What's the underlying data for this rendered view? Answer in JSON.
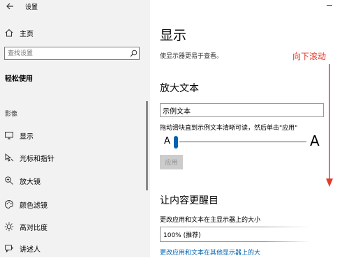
{
  "window": {
    "title": "设置"
  },
  "sidebar": {
    "home_label": "主页",
    "search_placeholder": "查找设置",
    "section_title": "轻松使用",
    "group_label": "影像",
    "items": [
      {
        "label": "显示",
        "icon": "monitor-icon"
      },
      {
        "label": "光标和指针",
        "icon": "cursor-icon"
      },
      {
        "label": "放大镜",
        "icon": "magnifier-icon"
      },
      {
        "label": "颜色滤镜",
        "icon": "color-filter-icon"
      },
      {
        "label": "高对比度",
        "icon": "contrast-icon"
      },
      {
        "label": "讲述人",
        "icon": "narrator-icon"
      }
    ]
  },
  "main": {
    "title": "显示",
    "subtitle": "使显示器更易于查看。",
    "annotation": "向下滚动",
    "text_size": {
      "heading": "放大文本",
      "sample_value": "示例文本",
      "instruction": "拖动滑块直到示例文本清晰可读，然后单击\"应用\"",
      "slider_min_label": "A",
      "slider_max_label": "A",
      "slider_value": 0.0,
      "apply_label": "应用"
    },
    "make_everything_bigger": {
      "heading": "让内容更醒目",
      "description": "更改应用和文本在主显示器上的大小",
      "select_value": "100% (推荐)",
      "link": "更改应用和文本在其他显示器上的大"
    }
  },
  "colors": {
    "accent": "#0063b1",
    "annotation": "#e23b2e"
  }
}
